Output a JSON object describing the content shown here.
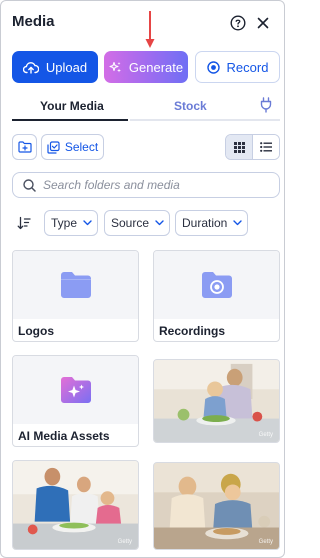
{
  "header": {
    "title": "Media"
  },
  "actions": {
    "upload_label": "Upload",
    "generate_label": "Generate",
    "record_label": "Record"
  },
  "tabs": [
    {
      "label": "Your Media",
      "active": true
    },
    {
      "label": "Stock",
      "active": false
    }
  ],
  "toolbar": {
    "select_label": "Select",
    "view": "grid"
  },
  "search": {
    "placeholder": "Search folders and media",
    "value": ""
  },
  "filters": [
    {
      "label": "Type"
    },
    {
      "label": "Source"
    },
    {
      "label": "Duration"
    }
  ],
  "items": [
    {
      "label": "Logos",
      "kind": "folder",
      "icon": "folder-icon"
    },
    {
      "label": "Recordings",
      "kind": "folder",
      "icon": "recording-folder-icon"
    },
    {
      "label": "AI Media Assets",
      "kind": "folder",
      "icon": "ai-folder-icon"
    },
    {
      "label": "",
      "kind": "photo",
      "watermark": "Getty"
    },
    {
      "label": "",
      "kind": "photo",
      "watermark": "Getty"
    },
    {
      "label": "",
      "kind": "photo",
      "watermark": "Getty"
    }
  ],
  "colors": {
    "primary": "#1456e6",
    "generate_gradient_start": "#d36de6",
    "generate_gradient_end": "#6f6ff4",
    "folder_icon": "#8b9cf3",
    "annotation_arrow": "#e64545"
  }
}
